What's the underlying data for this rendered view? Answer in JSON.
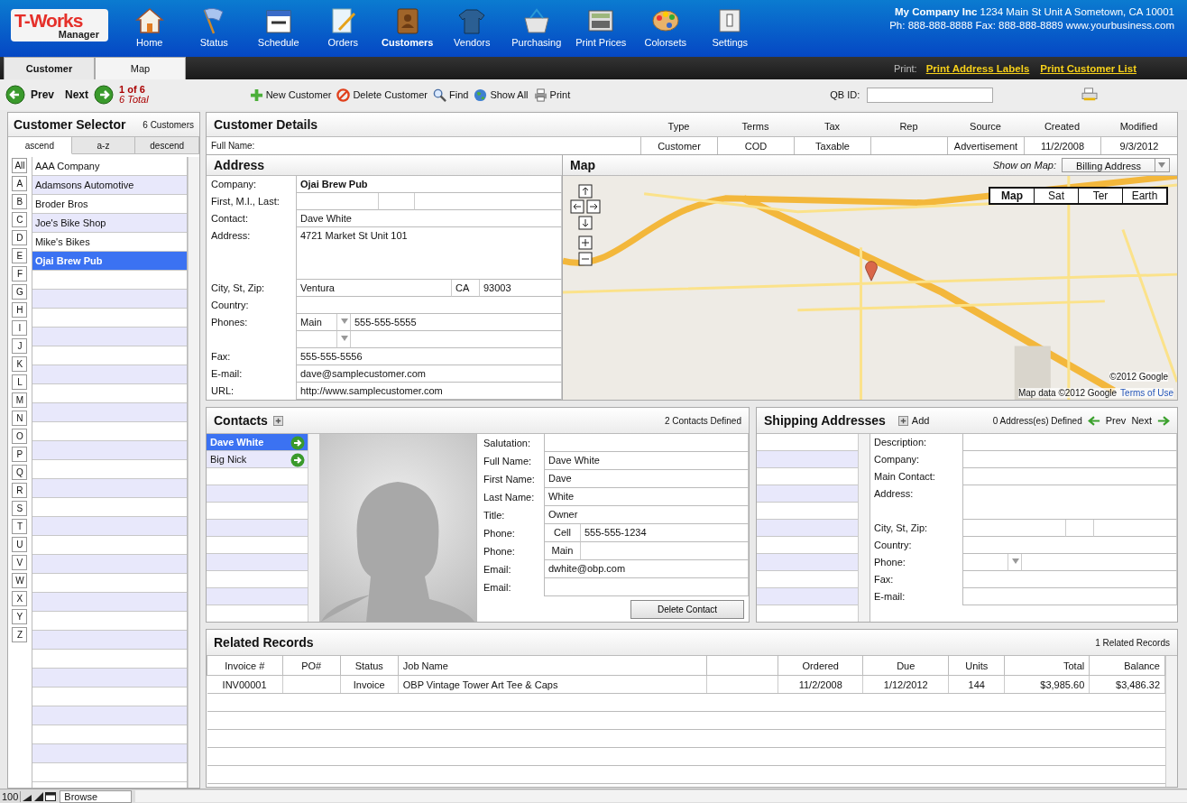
{
  "header": {
    "logo": {
      "title": "T-Works",
      "subtitle": "Manager"
    },
    "nav": [
      {
        "label": "Home",
        "selected": false
      },
      {
        "label": "Status",
        "selected": false
      },
      {
        "label": "Schedule",
        "selected": false
      },
      {
        "label": "Orders",
        "selected": false
      },
      {
        "label": "Customers",
        "selected": true
      },
      {
        "label": "Vendors",
        "selected": false
      },
      {
        "label": "Purchasing",
        "selected": false
      },
      {
        "label": "Print Prices",
        "selected": false
      },
      {
        "label": "Colorsets",
        "selected": false
      },
      {
        "label": "Settings",
        "selected": false
      }
    ],
    "company": {
      "name": "My Company Inc",
      "address": "1234 Main St Unit A Sometown, CA 10001",
      "contact": "Ph: 888-888-8888 Fax: 888-888-8889 www.yourbusiness.com"
    }
  },
  "tabs": [
    {
      "label": "Customer",
      "selected": true
    },
    {
      "label": "Map",
      "selected": false
    }
  ],
  "print_links": {
    "label": "Print:",
    "links": [
      "Print Address Labels",
      "Print Customer List"
    ]
  },
  "toolbar": {
    "prev": "Prev",
    "next": "Next",
    "position": "1 of 6",
    "total": "6 Total",
    "actions": [
      {
        "label": "New Customer"
      },
      {
        "label": "Delete Customer"
      },
      {
        "label": "Find"
      },
      {
        "label": "Show All"
      },
      {
        "label": "Print"
      }
    ],
    "qb_id_label": "QB ID:"
  },
  "selector": {
    "title": "Customer Selector",
    "count": "6 Customers",
    "sort_tabs": [
      {
        "label": "ascend",
        "selected": true
      },
      {
        "label": "a-z",
        "selected": false
      },
      {
        "label": "descend",
        "selected": false
      }
    ],
    "letters": [
      "All",
      "A",
      "B",
      "C",
      "D",
      "E",
      "F",
      "G",
      "H",
      "I",
      "J",
      "K",
      "L",
      "M",
      "N",
      "O",
      "P",
      "Q",
      "R",
      "S",
      "T",
      "U",
      "V",
      "W",
      "X",
      "Y",
      "Z"
    ],
    "customers": [
      {
        "name": "AAA Company",
        "selected": false
      },
      {
        "name": "Adamsons Automotive",
        "selected": false
      },
      {
        "name": "Broder Bros",
        "selected": false
      },
      {
        "name": "Joe's Bike Shop",
        "selected": false
      },
      {
        "name": "Mike's Bikes",
        "selected": false
      },
      {
        "name": "Ojai Brew Pub",
        "selected": true
      }
    ]
  },
  "details": {
    "title": "Customer Details",
    "full_name_label": "Full Name:",
    "columns": [
      {
        "heading": "Type",
        "value": "Customer"
      },
      {
        "heading": "Terms",
        "value": "COD"
      },
      {
        "heading": "Tax",
        "value": "Taxable"
      },
      {
        "heading": "Rep"
      },
      {
        "heading": "Source",
        "value": "Advertisement"
      },
      {
        "heading": "Created",
        "value": "11/2/2008"
      },
      {
        "heading": "Modified",
        "value": "9/3/2012"
      }
    ]
  },
  "address": {
    "title": "Address",
    "fields": [
      {
        "label": "Company:",
        "kind": "strong",
        "value": "Ojai Brew Pub"
      },
      {
        "label": "First, M.I., Last:",
        "kind": "name"
      },
      {
        "label": "Contact:",
        "kind": "text",
        "value": "Dave White"
      },
      {
        "label": "Address:",
        "kind": "multiline",
        "value": "4721 Market St Unit 101"
      },
      {
        "label": "City, St, Zip:",
        "kind": "city",
        "values": [
          "Ventura",
          "CA",
          "93003"
        ]
      },
      {
        "label": "Country:",
        "kind": "text"
      },
      {
        "label": "Phones:",
        "kind": "phone",
        "type": "Main",
        "value": "555-555-5555"
      },
      {
        "label": "Fax:",
        "kind": "text",
        "value": "555-555-5556"
      },
      {
        "label": "E-mail:",
        "kind": "text",
        "value": "dave@samplecustomer.com"
      },
      {
        "label": "URL:",
        "kind": "text",
        "value": "http://www.samplecustomer.com"
      }
    ]
  },
  "map": {
    "title": "Map",
    "show_on_label": "Show on Map:",
    "show_on_value": "Billing Address",
    "map_types": [
      {
        "label": "Map",
        "selected": true
      },
      {
        "label": "Sat",
        "selected": false
      },
      {
        "label": "Ter",
        "selected": false
      },
      {
        "label": "Earth",
        "selected": false
      }
    ],
    "copyright": "©2012 Google",
    "attribution": "Map data ©2012 Google",
    "terms": "Terms of Use"
  },
  "contacts": {
    "title": "Contacts",
    "count": "2 Contacts Defined",
    "list": [
      {
        "name": "Dave White",
        "selected": true
      },
      {
        "name": "Big Nick",
        "selected": false
      }
    ],
    "fields": [
      {
        "label": "Salutation:",
        "kind": "text"
      },
      {
        "label": "Full Name:",
        "kind": "text",
        "value": "Dave White"
      },
      {
        "label": "First Name:",
        "kind": "text",
        "value": "Dave"
      },
      {
        "label": "Last Name:",
        "kind": "text",
        "value": "White"
      },
      {
        "label": "Title:",
        "kind": "text",
        "value": "Owner"
      },
      {
        "label": "Phone:",
        "kind": "phone",
        "type": "Cell",
        "value": "555-555-1234"
      },
      {
        "label": "Phone:",
        "kind": "phone",
        "type": "Main"
      },
      {
        "label": "Email:",
        "kind": "text",
        "value": "dwhite@obp.com"
      },
      {
        "label": "Email:",
        "kind": "text"
      }
    ],
    "delete": "Delete Contact"
  },
  "shipping": {
    "title": "Shipping Addresses",
    "add": "Add",
    "count": "0 Address(es) Defined",
    "prev": "Prev",
    "next": "Next",
    "fields": [
      {
        "label": "Description:",
        "kind": "text"
      },
      {
        "label": "Company:",
        "kind": "text"
      },
      {
        "label": "Main Contact:",
        "kind": "text"
      },
      {
        "label": "Address:",
        "kind": "multiline"
      },
      {
        "label": "City, St, Zip:",
        "kind": "city"
      },
      {
        "label": "Country:",
        "kind": "text"
      },
      {
        "label": "Phone:",
        "kind": "phone"
      },
      {
        "label": "Fax:",
        "kind": "text"
      },
      {
        "label": "E-mail:",
        "kind": "text"
      }
    ]
  },
  "related": {
    "title": "Related Records",
    "count": "1 Related Records",
    "columns": [
      {
        "heading": "Invoice #"
      },
      {
        "heading": "PO#"
      },
      {
        "heading": "Status"
      },
      {
        "heading": "Job Name"
      },
      {},
      {
        "heading": "Ordered"
      },
      {
        "heading": "Due"
      },
      {
        "heading": "Units"
      },
      {
        "heading": "Total"
      },
      {
        "heading": "Balance"
      }
    ],
    "rows": [
      {
        "cells": [
          "INV00001",
          null,
          "Invoice",
          "OBP Vintage Tower Art Tee & Caps",
          null,
          "11/2/2008",
          "1/12/2012",
          "144",
          "$3,985.60",
          "$3,486.32"
        ]
      }
    ]
  },
  "status_bar": {
    "zoom": "100",
    "mode": "Browse"
  }
}
